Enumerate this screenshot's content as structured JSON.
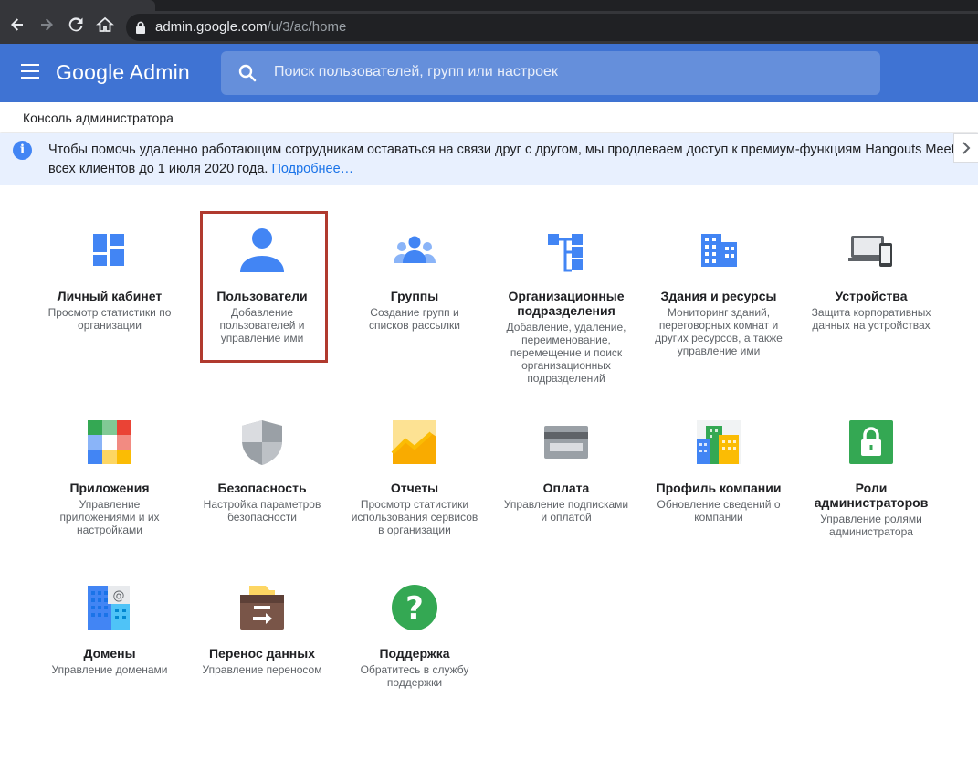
{
  "browser": {
    "url_host": "admin.google.com",
    "url_path": "/u/3/ac/home"
  },
  "header": {
    "brand": "Google Admin",
    "search_placeholder": "Поиск пользователей, групп или настроек"
  },
  "breadcrumb": "Консоль администратора",
  "banner": {
    "line1": "Чтобы помочь удаленно работающим сотрудникам оставаться на связи друг с другом, мы продлеваем доступ к премиум-функциям Hangouts Meet для",
    "line2": "всех клиентов до 1 июля 2020 года.",
    "link": "Подробнее…"
  },
  "tiles": [
    {
      "title": "Личный кабинет",
      "desc": "Просмотр статистики по организации",
      "icon": "dashboard-icon"
    },
    {
      "title": "Пользователи",
      "desc": "Добавление пользователей и управление ими",
      "icon": "user-icon"
    },
    {
      "title": "Группы",
      "desc": "Создание групп и списков рассылки",
      "icon": "groups-icon"
    },
    {
      "title": "Организационные подразделения",
      "desc": "Добавление, удаление, переименование, перемещение и поиск организационных подразделений",
      "icon": "org-units-icon"
    },
    {
      "title": "Здания и ресурсы",
      "desc": "Мониторинг зданий, переговорных комнат и других ресурсов, а также управление ими",
      "icon": "building-icon"
    },
    {
      "title": "Устройства",
      "desc": "Защита корпоративных данных на устройствах",
      "icon": "devices-icon"
    },
    {
      "title": "Приложения",
      "desc": "Управление приложениями и их настройками",
      "icon": "apps-icon"
    },
    {
      "title": "Безопасность",
      "desc": "Настройка параметров безопасности",
      "icon": "shield-icon"
    },
    {
      "title": "Отчеты",
      "desc": "Просмотр статистики использования сервисов в организации",
      "icon": "reports-icon"
    },
    {
      "title": "Оплата",
      "desc": "Управление подписками и оплатой",
      "icon": "credit-card-icon"
    },
    {
      "title": "Профиль компании",
      "desc": "Обновление сведений о компании",
      "icon": "company-profile-icon"
    },
    {
      "title": "Роли администраторов",
      "desc": "Управление ролями администратора",
      "icon": "lock-icon"
    },
    {
      "title": "Домены",
      "desc": "Управление доменами",
      "icon": "domains-icon"
    },
    {
      "title": "Перенос данных",
      "desc": "Управление переносом",
      "icon": "data-migration-icon"
    },
    {
      "title": "Поддержка",
      "desc": "Обратитесь в службу поддержки",
      "icon": "help-icon"
    }
  ]
}
